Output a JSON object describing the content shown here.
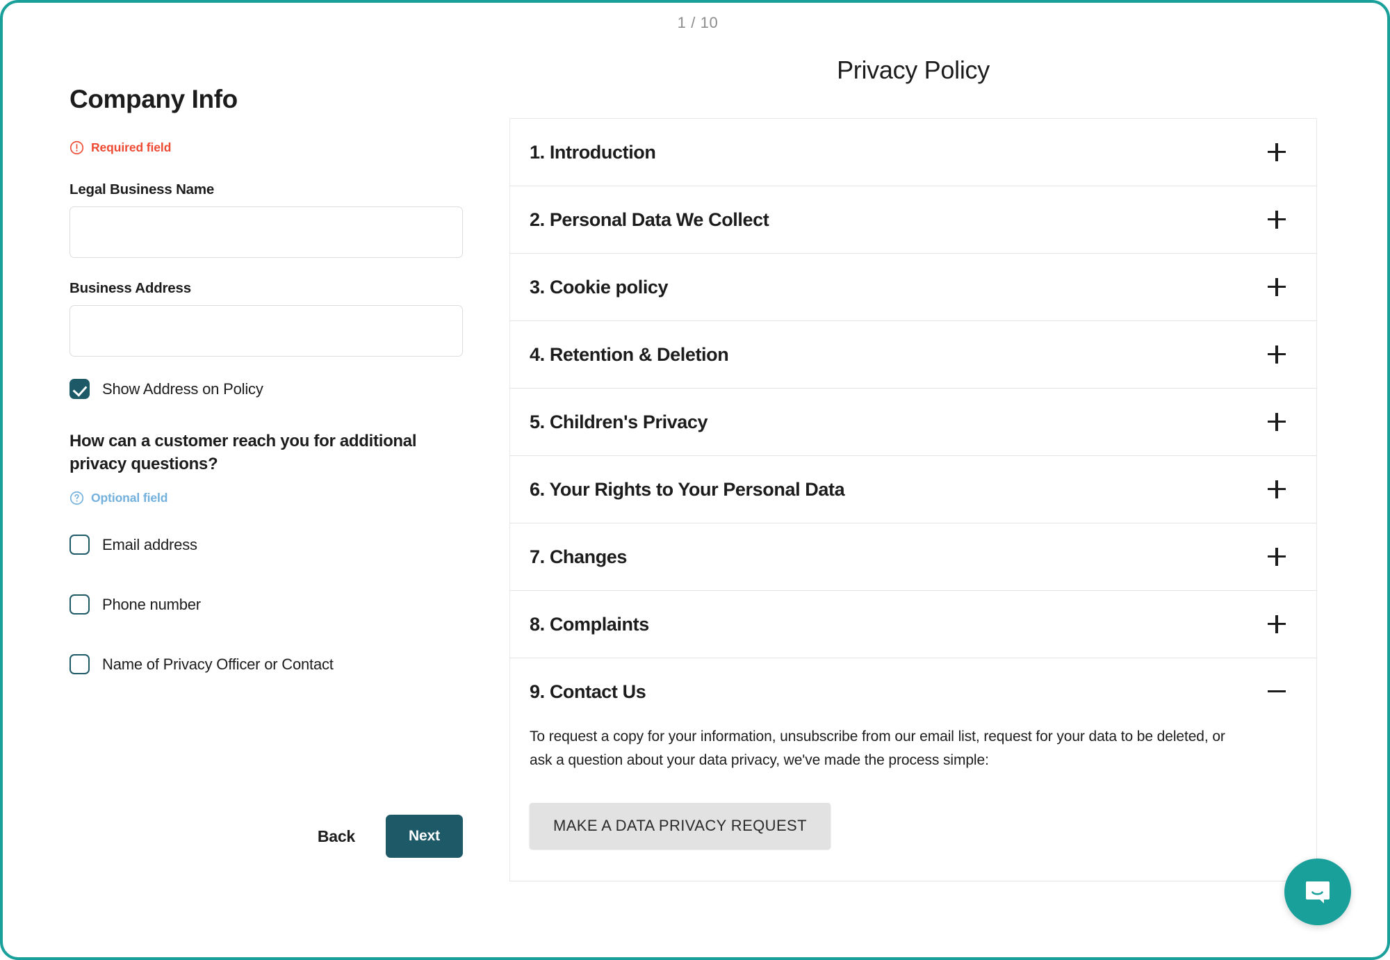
{
  "page_counter": "1 / 10",
  "form": {
    "title": "Company Info",
    "required_hint": "Required field",
    "required_icon": "exclamation-circle-icon",
    "required_color": "#ef4a33",
    "legal_name_label": "Legal Business Name",
    "legal_name_value": "",
    "business_address_label": "Business Address",
    "business_address_value": "",
    "show_address_label": "Show Address on Policy",
    "show_address_checked": true,
    "question": "How can a customer reach you for additional privacy questions?",
    "optional_hint": "Optional field",
    "optional_icon": "question-circle-icon",
    "optional_color": "#72b0dd",
    "contact_options": [
      {
        "label": "Email address",
        "checked": false
      },
      {
        "label": "Phone number",
        "checked": false
      },
      {
        "label": "Name of Privacy Officer or Contact",
        "checked": false
      }
    ],
    "back_label": "Back",
    "next_label": "Next",
    "accent_color": "#1d5966"
  },
  "policy": {
    "title": "Privacy Policy",
    "sections": [
      {
        "title": "1. Introduction",
        "expanded": false,
        "icon": "plus-icon"
      },
      {
        "title": "2. Personal Data We Collect",
        "expanded": false,
        "icon": "plus-icon"
      },
      {
        "title": "3. Cookie policy",
        "expanded": false,
        "icon": "plus-icon"
      },
      {
        "title": "4. Retention & Deletion",
        "expanded": false,
        "icon": "plus-icon"
      },
      {
        "title": "5. Children's Privacy",
        "expanded": false,
        "icon": "plus-icon"
      },
      {
        "title": "6. Your Rights to Your Personal Data",
        "expanded": false,
        "icon": "plus-icon"
      },
      {
        "title": "7. Changes",
        "expanded": false,
        "icon": "plus-icon"
      },
      {
        "title": "8. Complaints",
        "expanded": false,
        "icon": "plus-icon"
      },
      {
        "title": "9. Contact Us",
        "expanded": true,
        "icon": "minus-icon"
      }
    ],
    "contact_body": "To request a copy for your information, unsubscribe from our email list, request for your data to be deleted, or ask a question about your data privacy, we've made the process simple:",
    "request_button_label": "MAKE A DATA PRIVACY REQUEST"
  },
  "chat": {
    "icon": "chat-bubble-icon",
    "color": "#1aa09a"
  },
  "frame_color": "#1aa09a"
}
